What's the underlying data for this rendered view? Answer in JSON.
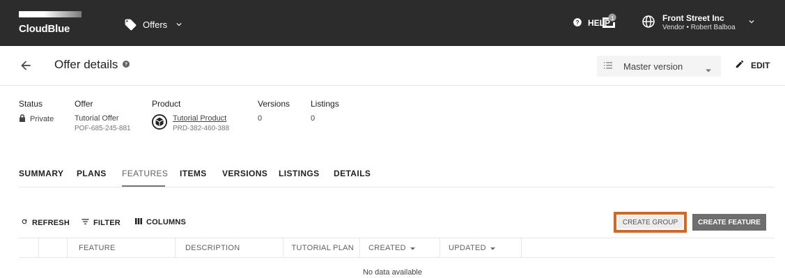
{
  "topbar": {
    "logo_text": "CloudBlue",
    "module_label": "Offers",
    "help_label": "HELP",
    "notifications_count": "1",
    "account_name": "Front Street Inc",
    "account_sub": "Vendor • Robert Balboa"
  },
  "header": {
    "title": "Offer details",
    "version_label": "Master version",
    "edit_label": "EDIT"
  },
  "info": {
    "status_label": "Status",
    "status_value": "Private",
    "offer_label": "Offer",
    "offer_name": "Tutorial Offer",
    "offer_id": "POF-685-245-881",
    "product_label": "Product",
    "product_name": "Tutorial Product",
    "product_id": "PRD-382-460-388",
    "versions_label": "Versions",
    "versions_value": "0",
    "listings_label": "Listings",
    "listings_value": "0"
  },
  "tabs": [
    "SUMMARY",
    "PLANS",
    "FEATURES",
    "ITEMS",
    "VERSIONS",
    "LISTINGS",
    "DETAILS"
  ],
  "active_tab": "FEATURES",
  "toolbar": {
    "refresh": "REFRESH",
    "filter": "FILTER",
    "columns": "COLUMNS",
    "create_group": "CREATE GROUP",
    "create_feature": "CREATE FEATURE"
  },
  "table": {
    "columns": [
      "FEATURE",
      "DESCRIPTION",
      "TUTORIAL PLAN",
      "CREATED",
      "UPDATED"
    ],
    "empty_text": "No data available"
  },
  "colors": {
    "topbar": "#2c2c2c",
    "highlight": "#d9661e",
    "primary_button": "#6e6e6e"
  }
}
